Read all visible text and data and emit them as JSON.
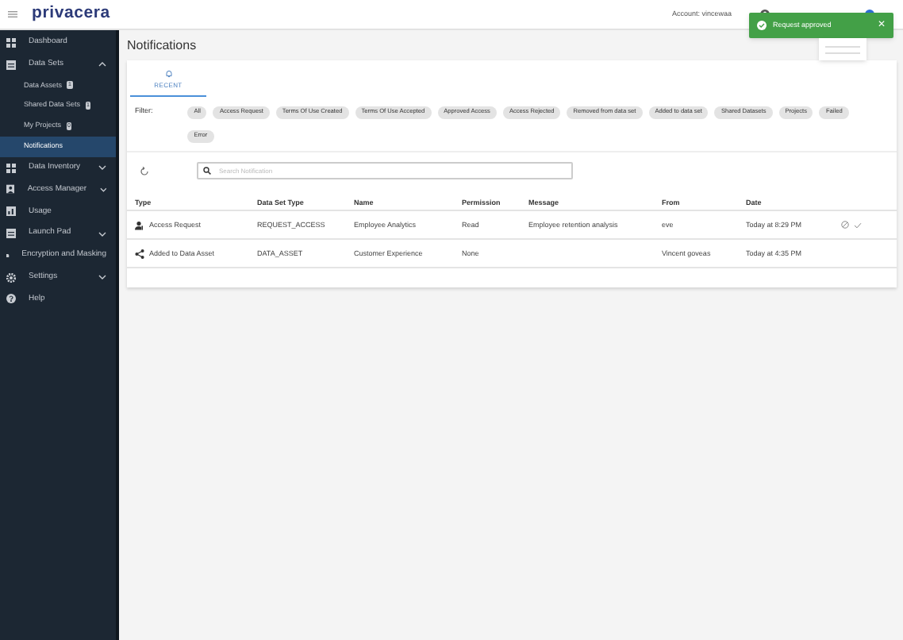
{
  "header": {
    "logo": "privacera",
    "account": "Account: vincewaa"
  },
  "toast": {
    "message": "Request approved",
    "close": "✕"
  },
  "sidebar": {
    "items": [
      {
        "label": "Dashboard",
        "kind": "grid",
        "selected": false
      },
      {
        "label": "Data Sets",
        "kind": "table",
        "selected": false,
        "expanded": true,
        "children": [
          {
            "label": "Data Assets",
            "count": "1",
            "selected": false
          },
          {
            "label": "Shared Data Sets",
            "count": "1",
            "selected": false
          },
          {
            "label": "My Projects",
            "count": "0",
            "selected": false
          },
          {
            "label": "Notifications",
            "selected": true
          }
        ]
      },
      {
        "label": "Data Inventory",
        "kind": "grid",
        "selected": false,
        "expanded": false
      },
      {
        "label": "Access Manager",
        "kind": "person",
        "selected": false,
        "expanded": false
      },
      {
        "label": "Usage",
        "kind": "chart",
        "selected": false
      },
      {
        "label": "Launch Pad",
        "kind": "table",
        "selected": false,
        "expanded": false
      },
      {
        "label": "Encryption and Masking",
        "kind": "doc",
        "selected": false
      },
      {
        "label": "Settings",
        "kind": "gear",
        "selected": false,
        "expanded": false
      },
      {
        "label": "Help",
        "kind": "help",
        "selected": false
      }
    ]
  },
  "page_title": "Notifications",
  "tabs": [
    {
      "label": "RECENT",
      "selected": true
    }
  ],
  "filter": {
    "label": "Filter:",
    "chips": [
      "All",
      "Access Request",
      "Terms Of Use Created",
      "Terms Of Use Accepted",
      "Approved Access",
      "Access Rejected",
      "Removed from data set",
      "Added to data set",
      "Shared Datasets",
      "Projects",
      "Failed",
      "Error"
    ]
  },
  "search": {
    "placeholder": "Search Notification"
  },
  "table": {
    "columns": [
      "Type",
      "Data Set Type",
      "Name",
      "Permission",
      "Message",
      "From",
      "Date"
    ],
    "rows": [
      {
        "kind": "request",
        "cells": [
          "Access Request",
          "REQUEST_ACCESS",
          "Employee Analytics",
          "Read",
          "Employee retention analysis",
          "eve",
          "Today at 8:29 PM"
        ],
        "actions": true
      },
      {
        "kind": "share",
        "cells": [
          "Added to Data Asset",
          "DATA_ASSET",
          "Customer Experience",
          "None",
          "",
          "Vincent goveas",
          "Today at 4:35 PM"
        ],
        "actions": false
      }
    ]
  }
}
